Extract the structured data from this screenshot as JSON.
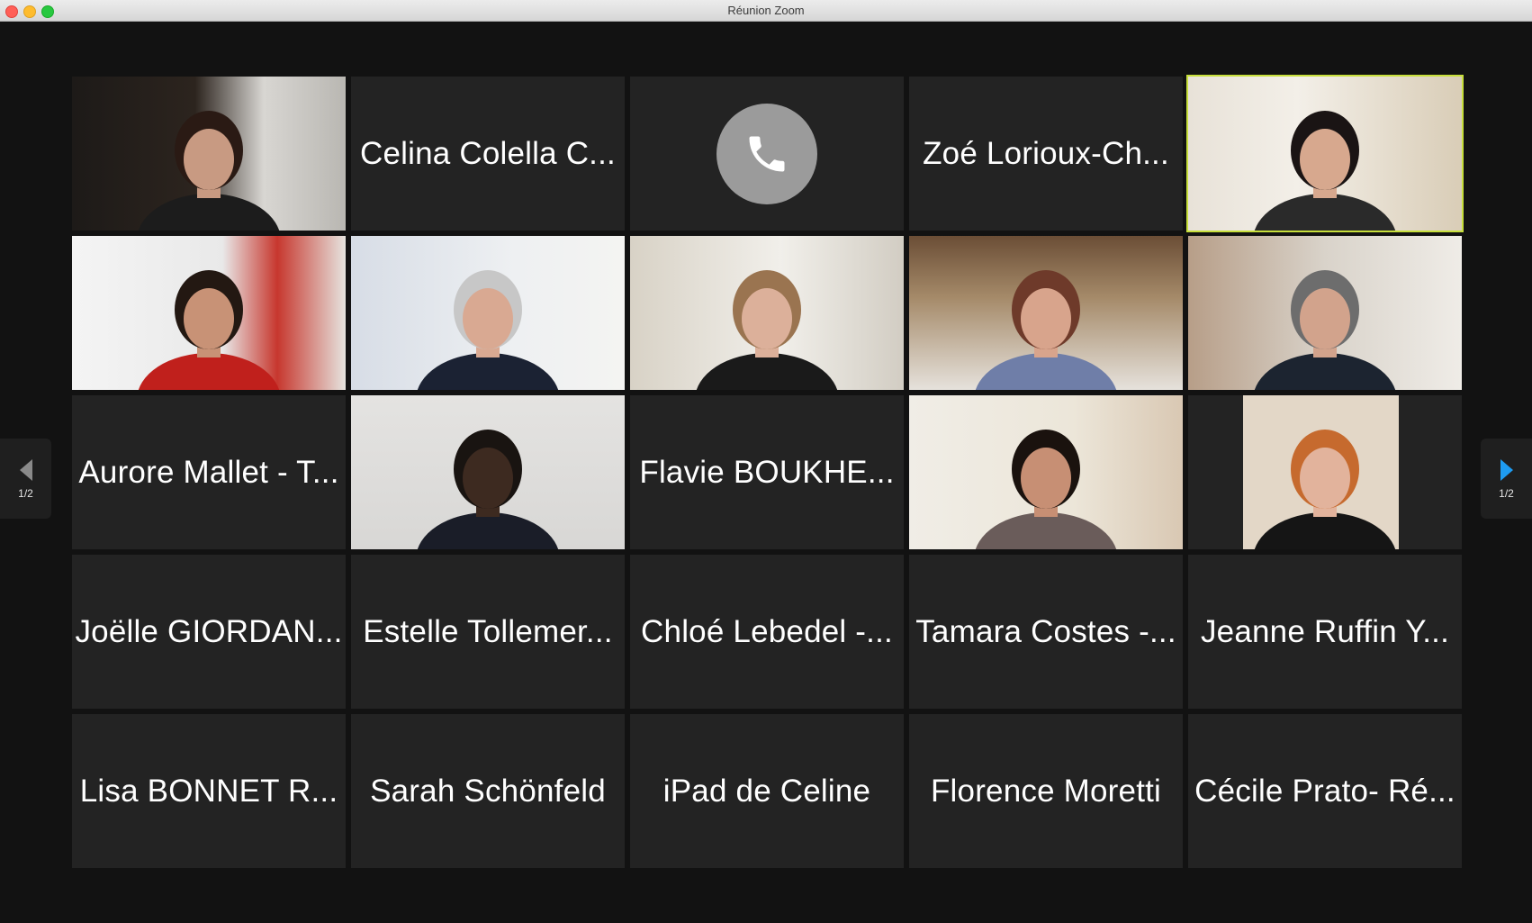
{
  "window": {
    "title": "Réunion Zoom"
  },
  "navigation": {
    "prev_page_label": "1/2",
    "next_page_label": "1/2"
  },
  "colors": {
    "active_speaker_border": "#c7df3b",
    "tile_background": "#232323",
    "phone_circle": "#9b9b9b",
    "next_arrow": "#1e9bf0"
  },
  "tiles": [
    {
      "type": "video"
    },
    {
      "type": "name",
      "name": "Celina Colella C..."
    },
    {
      "type": "phone",
      "icon": "phone-icon"
    },
    {
      "type": "name",
      "name": "Zoé Lorioux-Ch..."
    },
    {
      "type": "video",
      "active_speaker": true
    },
    {
      "type": "video"
    },
    {
      "type": "video"
    },
    {
      "type": "video"
    },
    {
      "type": "video"
    },
    {
      "type": "video"
    },
    {
      "type": "name",
      "name": "Aurore Mallet - T..."
    },
    {
      "type": "video"
    },
    {
      "type": "name",
      "name": "Flavie BOUKHE..."
    },
    {
      "type": "video"
    },
    {
      "type": "video"
    },
    {
      "type": "name",
      "name": "Joëlle GIORDAN..."
    },
    {
      "type": "name",
      "name": "Estelle Tollemer..."
    },
    {
      "type": "name",
      "name": "Chloé Lebedel -..."
    },
    {
      "type": "name",
      "name": "Tamara Costes -..."
    },
    {
      "type": "name",
      "name": "Jeanne Ruffin Y..."
    },
    {
      "type": "name",
      "name": "Lisa BONNET R..."
    },
    {
      "type": "name",
      "name": "Sarah Schönfeld"
    },
    {
      "type": "name",
      "name": "iPad de Celine"
    },
    {
      "type": "name",
      "name": "Florence Moretti"
    },
    {
      "type": "name",
      "name": "Cécile Prato- Ré..."
    }
  ]
}
